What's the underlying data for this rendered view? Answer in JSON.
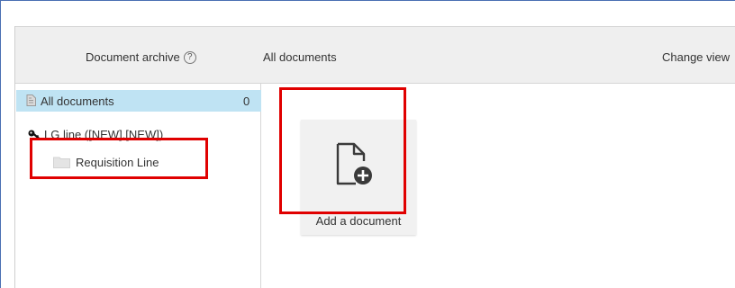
{
  "header": {
    "archive_label": "Document archive",
    "help_symbol": "?",
    "section_title": "All documents",
    "change_view": "Change view"
  },
  "sidebar": {
    "all_documents": {
      "label": "All documents",
      "count": "0"
    },
    "lg_line": {
      "label": "LG line ([NEW],[NEW])"
    },
    "requisition": {
      "label": "Requisition Line"
    }
  },
  "main": {
    "add_document_label": "Add a document"
  },
  "colors": {
    "highlight": "#e00000",
    "selected_row": "#bfe3f3",
    "header_bg": "#efefef"
  },
  "icons": {
    "help": "help-circle-icon",
    "document": "document-icon",
    "key": "key-icon",
    "folder": "folder-icon",
    "add_document": "document-add-icon"
  }
}
